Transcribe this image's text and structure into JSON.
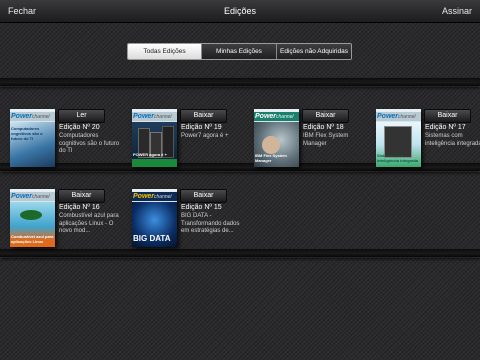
{
  "header": {
    "close": "Fechar",
    "title": "Edições",
    "subscribe": "Assinar"
  },
  "tabs": [
    "Todas Edições",
    "Minhas Edições",
    "Edições não Adquiridas"
  ],
  "brand": {
    "power": "Power",
    "channel": "channel"
  },
  "issues": [
    {
      "button": "Ler",
      "title": "Edição Nº 20",
      "desc": "Computadores cognitivos são o futuro do TI",
      "cover": "Computadores cognitivos são o futuro do TI"
    },
    {
      "button": "Baixar",
      "title": "Edição Nº 19",
      "desc": "Power7 agora é +",
      "cover": "POWER agora é +"
    },
    {
      "button": "Baixar",
      "title": "Edição Nº 18",
      "desc": "IBM Flex System Manager",
      "cover": "IBM Flex System Manager"
    },
    {
      "button": "Baixar",
      "title": "Edição Nº 17",
      "desc": "Sistemas com inteligência integrada.",
      "cover": "Sistemas com inteligência integrada"
    },
    {
      "button": "Baixar",
      "title": "Edição Nº 16",
      "desc": "Combustível azul para aplicações Linux - O novo mod...",
      "cover": "Combustível azul para aplicações Linux"
    },
    {
      "button": "Baixar",
      "title": "Edição Nº 15",
      "desc": "BIG DATA - Transformando dados em estratégias de...",
      "cover": "BIG DATA"
    }
  ],
  "colors": {
    "background": "#2b2b2d",
    "brand_blue": "#0a6fb8",
    "button": "#2e2e30"
  }
}
